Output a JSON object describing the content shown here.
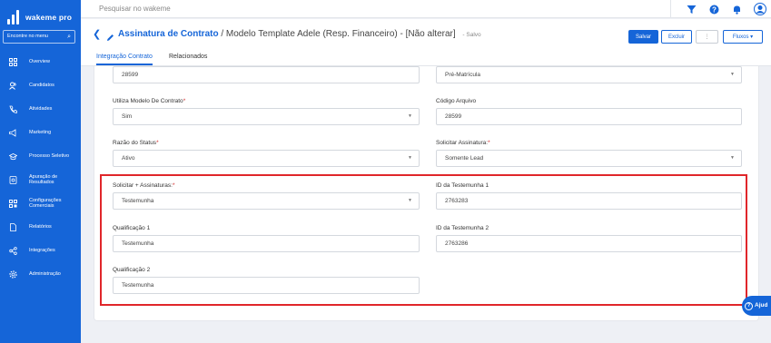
{
  "app": {
    "name": "wakeme pro"
  },
  "sidebar": {
    "search_label": "Encontre no menu",
    "items": [
      {
        "label": "Overview",
        "icon": "grid-icon"
      },
      {
        "label": "Candidatos",
        "icon": "users-icon"
      },
      {
        "label": "Atividades",
        "icon": "phone-icon"
      },
      {
        "label": "Marketing",
        "icon": "megaphone-icon"
      },
      {
        "label": "Processo Seletivo",
        "icon": "graduation-cap-icon"
      },
      {
        "label": "Apuração de Resultados",
        "icon": "report-icon"
      },
      {
        "label": "Configurações Comerciais",
        "icon": "settings-grid-icon"
      },
      {
        "label": "Relatórios",
        "icon": "document-icon"
      },
      {
        "label": "Integrações",
        "icon": "share-icon"
      },
      {
        "label": "Administração",
        "icon": "gear-icon"
      }
    ]
  },
  "topbar": {
    "search_placeholder": "Pesquisar no wakeme"
  },
  "header": {
    "title": "Assinatura de Contrato",
    "subtitle": "/ Modelo Template Adele (Resp. Financeiro) - [Não alterar]",
    "status": "- Salvo",
    "buttons": {
      "save": "Salvar",
      "delete": "Excluir",
      "more": "⋮",
      "flows": "Fluxos ▾"
    },
    "tabs": [
      "Integração Contrato",
      "Relacionados"
    ]
  },
  "form": {
    "top_left_value": "28599",
    "top_right_value": "Pré-Matrícula",
    "fields": [
      {
        "label": "Utiliza Modelo De Contrato",
        "required": true,
        "value": "Sim"
      },
      {
        "label": "Código Arquivo",
        "required": false,
        "value": "28599"
      },
      {
        "label": "Razão do Status",
        "required": true,
        "value": "Ativo"
      },
      {
        "label": "Solicitar Assinatura:",
        "required": true,
        "value": "Somente Lead"
      },
      {
        "label": "Solicitar + Assinaturas:",
        "required": true,
        "value": "Testemunha"
      },
      {
        "label": "ID da Testemunha 1",
        "required": false,
        "value": "2763283"
      },
      {
        "label": "Qualificação 1",
        "required": false,
        "value": "Testemunha"
      },
      {
        "label": "ID da Testemunha 2",
        "required": false,
        "value": "2763286"
      },
      {
        "label": "Qualificação 2",
        "required": false,
        "value": "Testemunha"
      }
    ]
  },
  "help": {
    "label": "Ajud"
  },
  "colors": {
    "primary": "#1565d8",
    "highlight": "#e0262a",
    "background": "#eef0f5"
  }
}
